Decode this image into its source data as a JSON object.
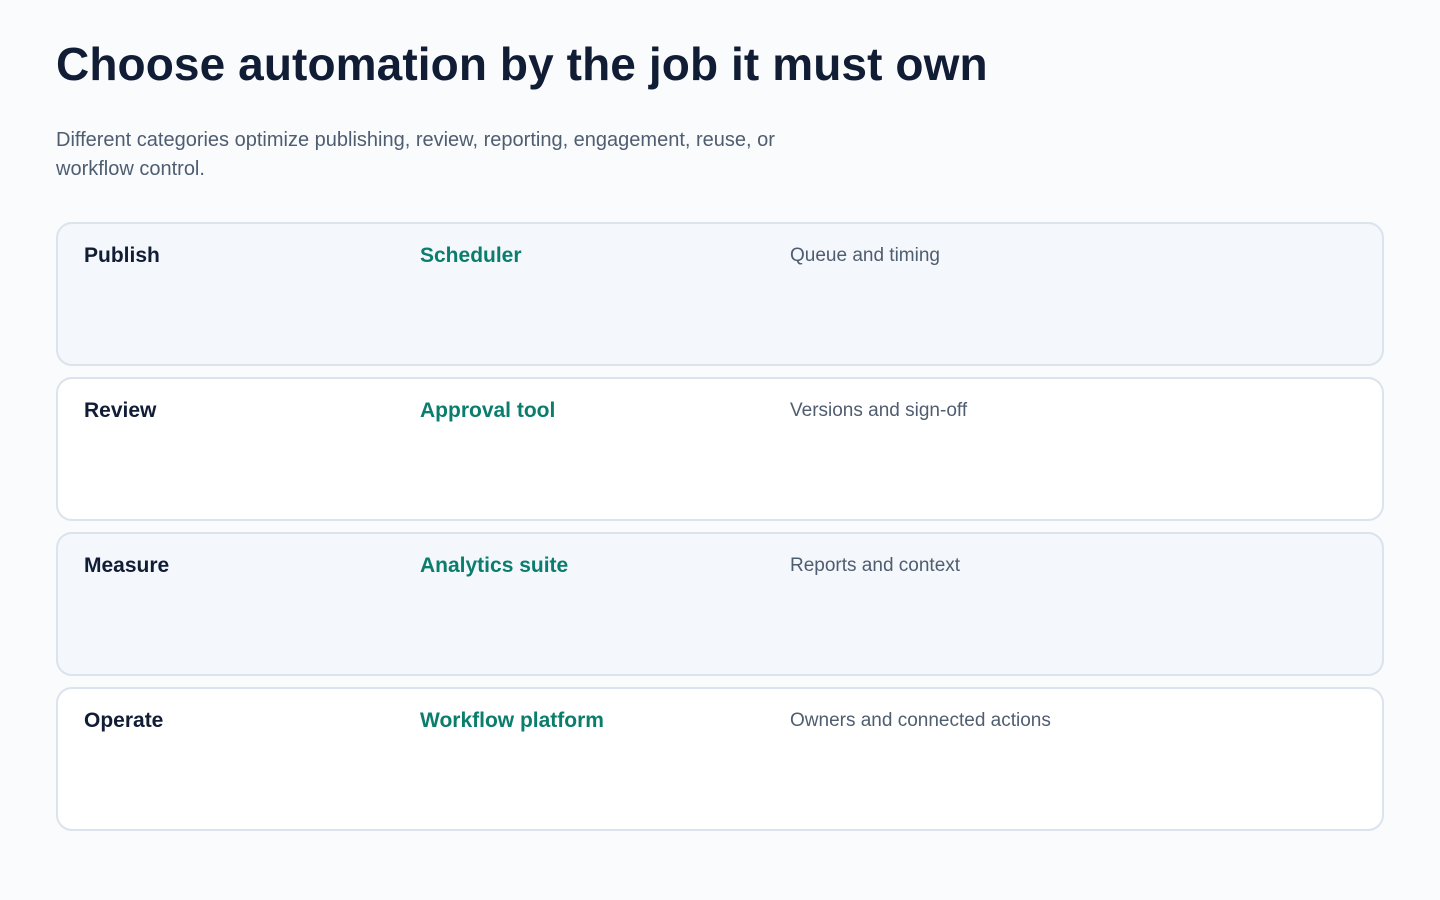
{
  "header": {
    "title": "Choose automation by the job it must own",
    "subtitle": "Different categories optimize publishing, review, reporting, engagement, reuse, or workflow control."
  },
  "rows": [
    {
      "job": "Publish",
      "tool": "Scheduler",
      "description": "Queue and timing"
    },
    {
      "job": "Review",
      "tool": "Approval tool",
      "description": "Versions and sign-off"
    },
    {
      "job": "Measure",
      "tool": "Analytics suite",
      "description": "Reports and context"
    },
    {
      "job": "Operate",
      "tool": "Workflow platform",
      "description": "Owners and connected actions"
    }
  ],
  "colors": {
    "title": "#111d35",
    "body_text": "#4f5d70",
    "accent": "#0b7d6c",
    "card_border": "#dbe3ed",
    "card_shaded": "#f4f7fc",
    "card_plain": "#ffffff",
    "page_background": "#f9fbfd"
  }
}
